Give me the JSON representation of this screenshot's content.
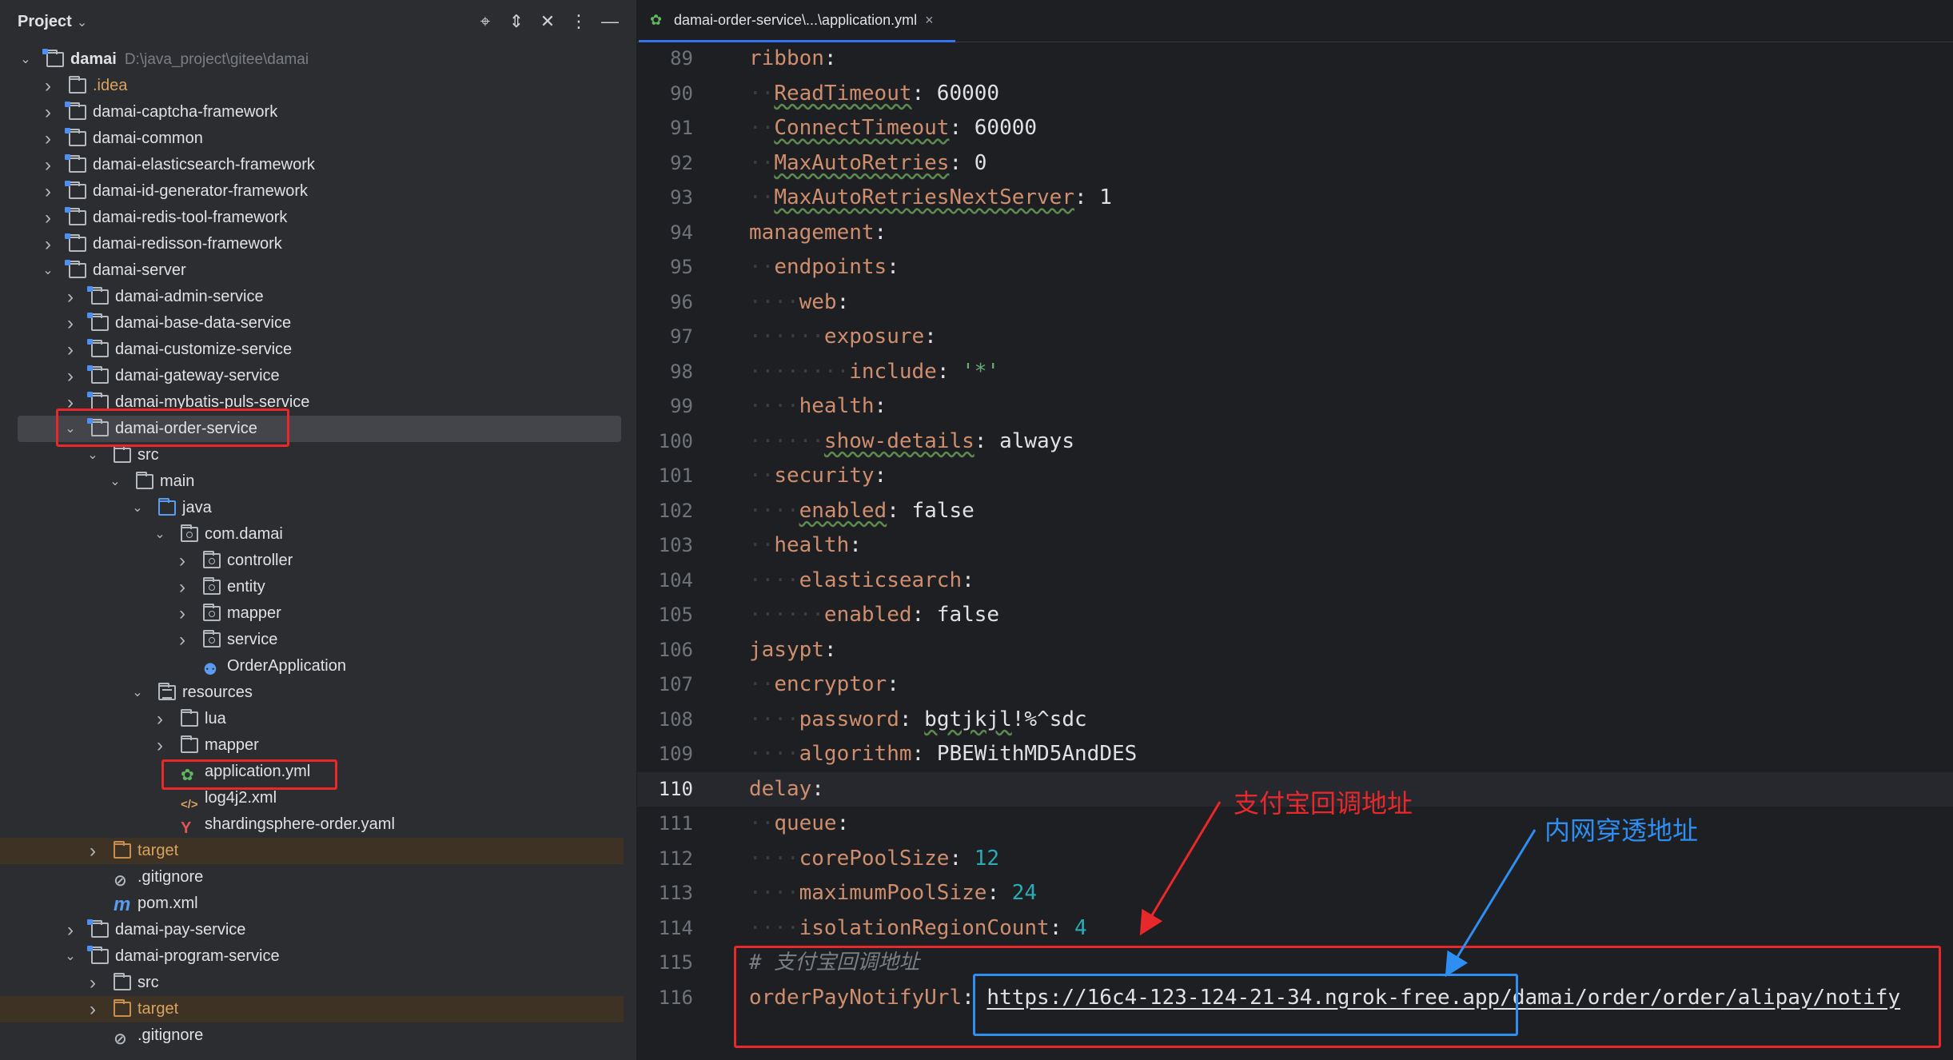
{
  "project": {
    "title": "Project",
    "header_icons": [
      "locate-icon",
      "expand-all-icon",
      "collapse-all-icon",
      "more-options-icon",
      "hide-icon"
    ],
    "tree": [
      {
        "label": "damai",
        "hint": "D:\\java_project\\gitee\\damai",
        "depth": 0,
        "arrow": "v",
        "icon": "module"
      },
      {
        "label": ".idea",
        "depth": 1,
        "arrow": ">",
        "icon": "folder",
        "color": "orange"
      },
      {
        "label": "damai-captcha-framework",
        "depth": 1,
        "arrow": ">",
        "icon": "module"
      },
      {
        "label": "damai-common",
        "depth": 1,
        "arrow": ">",
        "icon": "module"
      },
      {
        "label": "damai-elasticsearch-framework",
        "depth": 1,
        "arrow": ">",
        "icon": "module"
      },
      {
        "label": "damai-id-generator-framework",
        "depth": 1,
        "arrow": ">",
        "icon": "module"
      },
      {
        "label": "damai-redis-tool-framework",
        "depth": 1,
        "arrow": ">",
        "icon": "module"
      },
      {
        "label": "damai-redisson-framework",
        "depth": 1,
        "arrow": ">",
        "icon": "module"
      },
      {
        "label": "damai-server",
        "depth": 1,
        "arrow": "v",
        "icon": "module"
      },
      {
        "label": "damai-admin-service",
        "depth": 2,
        "arrow": ">",
        "icon": "module"
      },
      {
        "label": "damai-base-data-service",
        "depth": 2,
        "arrow": ">",
        "icon": "module"
      },
      {
        "label": "damai-customize-service",
        "depth": 2,
        "arrow": ">",
        "icon": "module"
      },
      {
        "label": "damai-gateway-service",
        "depth": 2,
        "arrow": ">",
        "icon": "module"
      },
      {
        "label": "damai-mybatis-puls-service",
        "depth": 2,
        "arrow": ">",
        "icon": "module"
      },
      {
        "label": "damai-order-service",
        "depth": 2,
        "arrow": "v",
        "icon": "module",
        "selected": true
      },
      {
        "label": "src",
        "depth": 3,
        "arrow": "v",
        "icon": "folder"
      },
      {
        "label": "main",
        "depth": 4,
        "arrow": "v",
        "icon": "folder"
      },
      {
        "label": "java",
        "depth": 5,
        "arrow": "v",
        "icon": "folder-blue"
      },
      {
        "label": "com.damai",
        "depth": 6,
        "arrow": "v",
        "icon": "package"
      },
      {
        "label": "controller",
        "depth": 7,
        "arrow": ">",
        "icon": "package"
      },
      {
        "label": "entity",
        "depth": 7,
        "arrow": ">",
        "icon": "package"
      },
      {
        "label": "mapper",
        "depth": 7,
        "arrow": ">",
        "icon": "package"
      },
      {
        "label": "service",
        "depth": 7,
        "arrow": ">",
        "icon": "package"
      },
      {
        "label": "OrderApplication",
        "depth": 7,
        "arrow": "",
        "icon": "spring-class"
      },
      {
        "label": "resources",
        "depth": 5,
        "arrow": "v",
        "icon": "resources"
      },
      {
        "label": "lua",
        "depth": 6,
        "arrow": ">",
        "icon": "folder"
      },
      {
        "label": "mapper",
        "depth": 6,
        "arrow": ">",
        "icon": "folder"
      },
      {
        "label": "application.yml",
        "depth": 6,
        "arrow": "",
        "icon": "yml"
      },
      {
        "label": "log4j2.xml",
        "depth": 6,
        "arrow": "",
        "icon": "xml"
      },
      {
        "label": "shardingsphere-order.yaml",
        "depth": 6,
        "arrow": "",
        "icon": "yaml"
      },
      {
        "label": "target",
        "depth": 3,
        "arrow": ">",
        "icon": "folder-orange",
        "color": "orange",
        "excluded": true
      },
      {
        "label": ".gitignore",
        "depth": 3,
        "arrow": "",
        "icon": "gitignore"
      },
      {
        "label": "pom.xml",
        "depth": 3,
        "arrow": "",
        "icon": "maven"
      },
      {
        "label": "damai-pay-service",
        "depth": 2,
        "arrow": ">",
        "icon": "module"
      },
      {
        "label": "damai-program-service",
        "depth": 2,
        "arrow": "v",
        "icon": "module"
      },
      {
        "label": "src",
        "depth": 3,
        "arrow": ">",
        "icon": "folder"
      },
      {
        "label": "target",
        "depth": 3,
        "arrow": ">",
        "icon": "folder-orange",
        "color": "orange",
        "excluded": true
      },
      {
        "label": ".gitignore",
        "depth": 3,
        "arrow": "",
        "icon": "gitignore"
      }
    ]
  },
  "editor": {
    "tab_label": "damai-order-service\\...\\application.yml",
    "tab_icon": "yml-file-icon",
    "lines": [
      {
        "n": "89",
        "indent": 0,
        "parts": [
          [
            "k",
            "ribbon"
          ],
          [
            "v",
            ":"
          ]
        ]
      },
      {
        "n": "90",
        "indent": 1,
        "parts": [
          [
            "ku",
            "ReadTimeout"
          ],
          [
            "v",
            ": 60000"
          ]
        ]
      },
      {
        "n": "91",
        "indent": 1,
        "parts": [
          [
            "ku",
            "ConnectTimeout"
          ],
          [
            "v",
            ": 60000"
          ]
        ]
      },
      {
        "n": "92",
        "indent": 1,
        "parts": [
          [
            "ku",
            "MaxAutoRetries"
          ],
          [
            "v",
            ": 0"
          ]
        ]
      },
      {
        "n": "93",
        "indent": 1,
        "parts": [
          [
            "ku",
            "MaxAutoRetriesNextServer"
          ],
          [
            "v",
            ": 1"
          ]
        ]
      },
      {
        "n": "94",
        "indent": 0,
        "parts": [
          [
            "k",
            "management"
          ],
          [
            "v",
            ":"
          ]
        ]
      },
      {
        "n": "95",
        "indent": 1,
        "parts": [
          [
            "k",
            "endpoints"
          ],
          [
            "v",
            ":"
          ]
        ]
      },
      {
        "n": "96",
        "indent": 2,
        "parts": [
          [
            "k",
            "web"
          ],
          [
            "v",
            ":"
          ]
        ]
      },
      {
        "n": "97",
        "indent": 3,
        "parts": [
          [
            "k",
            "exposure"
          ],
          [
            "v",
            ":"
          ]
        ]
      },
      {
        "n": "98",
        "indent": 4,
        "parts": [
          [
            "k",
            "include"
          ],
          [
            "v",
            ": "
          ],
          [
            "s",
            "'*'"
          ]
        ]
      },
      {
        "n": "99",
        "indent": 2,
        "parts": [
          [
            "k",
            "health"
          ],
          [
            "v",
            ":"
          ]
        ]
      },
      {
        "n": "100",
        "indent": 3,
        "parts": [
          [
            "ku",
            "show-details"
          ],
          [
            "v",
            ": always"
          ]
        ]
      },
      {
        "n": "101",
        "indent": 1,
        "parts": [
          [
            "k",
            "security"
          ],
          [
            "v",
            ":"
          ]
        ]
      },
      {
        "n": "102",
        "indent": 2,
        "parts": [
          [
            "ku",
            "enabled"
          ],
          [
            "v",
            ": false"
          ]
        ]
      },
      {
        "n": "103",
        "indent": 1,
        "parts": [
          [
            "k",
            "health"
          ],
          [
            "v",
            ":"
          ]
        ]
      },
      {
        "n": "104",
        "indent": 2,
        "parts": [
          [
            "k",
            "elasticsearch"
          ],
          [
            "v",
            ":"
          ]
        ]
      },
      {
        "n": "105",
        "indent": 3,
        "parts": [
          [
            "k",
            "enabled"
          ],
          [
            "v",
            ": false"
          ]
        ]
      },
      {
        "n": "106",
        "indent": 0,
        "parts": [
          [
            "k",
            "jasypt"
          ],
          [
            "v",
            ":"
          ]
        ]
      },
      {
        "n": "107",
        "indent": 1,
        "parts": [
          [
            "k",
            "encryptor"
          ],
          [
            "v",
            ":"
          ]
        ]
      },
      {
        "n": "108",
        "indent": 2,
        "parts": [
          [
            "k",
            "password"
          ],
          [
            "v",
            ": "
          ],
          [
            "vu",
            "bgtjkjl"
          ],
          [
            "v",
            "!%^sdc"
          ]
        ]
      },
      {
        "n": "109",
        "indent": 2,
        "parts": [
          [
            "k",
            "algorithm"
          ],
          [
            "v",
            ": PBEWithMD5AndDES"
          ]
        ]
      },
      {
        "n": "110",
        "indent": 0,
        "parts": [
          [
            "k",
            "delay"
          ],
          [
            "v",
            ":"
          ]
        ],
        "current": true
      },
      {
        "n": "111",
        "indent": 1,
        "parts": [
          [
            "k",
            "queue"
          ],
          [
            "v",
            ":"
          ]
        ]
      },
      {
        "n": "112",
        "indent": 2,
        "parts": [
          [
            "k",
            "corePoolSize"
          ],
          [
            "v",
            ": "
          ],
          [
            "n",
            "12"
          ]
        ]
      },
      {
        "n": "113",
        "indent": 2,
        "parts": [
          [
            "k",
            "maximumPoolSize"
          ],
          [
            "v",
            ": "
          ],
          [
            "n",
            "24"
          ]
        ]
      },
      {
        "n": "114",
        "indent": 2,
        "parts": [
          [
            "k",
            "isolationRegionCount"
          ],
          [
            "v",
            ": "
          ],
          [
            "n",
            "4"
          ]
        ]
      },
      {
        "n": "115",
        "indent": 0,
        "parts": [
          [
            "c",
            "# 支付宝回调地址"
          ]
        ]
      },
      {
        "n": "116",
        "indent": 0,
        "parts": [
          [
            "k",
            "orderPayNotifyUrl"
          ],
          [
            "v",
            ": "
          ],
          [
            "vul",
            "https://16c4-123-124-21-34.ngrok-free.app/damai/order/order/alipay/notify"
          ]
        ]
      }
    ]
  },
  "annotations": {
    "alipay_callback": "支付宝回调地址",
    "tunnel_address": "内网穿透地址",
    "red_color": "#e8282b",
    "blue_color": "#2f8ef2"
  }
}
